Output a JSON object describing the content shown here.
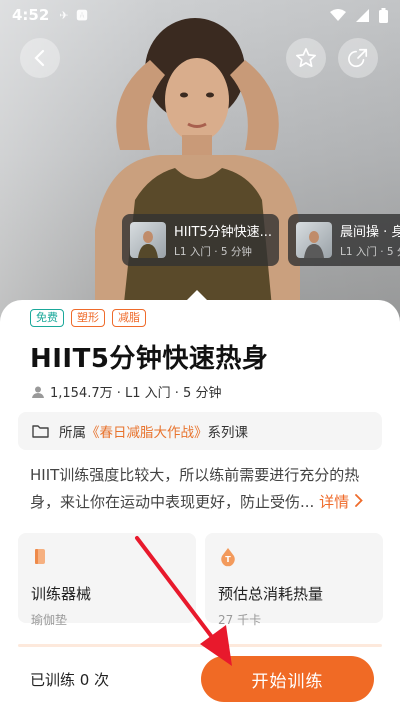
{
  "status_bar": {
    "time": "4:52",
    "left_icons": [
      "signal-app-icon",
      "a-notification-icon"
    ],
    "right_icons": [
      "wifi-icon",
      "cell-signal-icon",
      "battery-icon"
    ]
  },
  "header": {
    "icons": [
      "back-icon",
      "star-icon",
      "share-icon"
    ]
  },
  "related_courses": [
    {
      "title": "HIIT5分钟快速...",
      "sub": "L1 入门 · 5 分钟"
    },
    {
      "title": "晨间操 · 身",
      "sub": "L1 入门 · 5 分钟"
    }
  ],
  "course": {
    "tags": [
      "免费",
      "塑形",
      "减脂"
    ],
    "title": "HIIT5分钟快速热身",
    "meta": "1,154.7万 · L1 入门 · 5 分钟",
    "series_prefix": "所属",
    "series_name": "《春日减脂大作战》",
    "series_suffix": "系列课",
    "description": "HIIT训练强度比较大，所以练前需要进行充分的热身，来让你在运动中表现更好，防止受伤...",
    "more_label": "详情"
  },
  "info": {
    "equipment_label": "训练器械",
    "equipment_value": "瑜伽垫",
    "calories_label": "预估总消耗热量",
    "calories_value": "27 千卡"
  },
  "footer": {
    "trained_text": "已训练 0 次",
    "start_label": "开始训练"
  },
  "colors": {
    "accent": "#f06a25",
    "tag_free": "#1aa89a",
    "series_highlight": "#e8732d"
  }
}
